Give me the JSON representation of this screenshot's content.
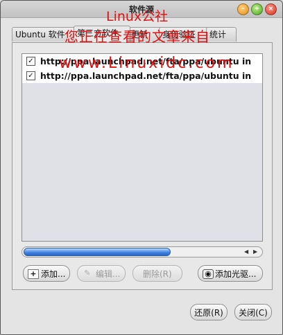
{
  "window": {
    "title": "软件源"
  },
  "tabs": [
    {
      "label": "Ubuntu 软件"
    },
    {
      "label": "第三方软件"
    },
    {
      "label": "更新"
    },
    {
      "label": "身份验证"
    },
    {
      "label": "统计"
    }
  ],
  "sources": [
    {
      "checked": true,
      "text": "http://ppa.launchpad.net/fta/ppa/ubuntu in"
    },
    {
      "checked": true,
      "text": "http://ppa.launchpad.net/fta/ppa/ubuntu in"
    }
  ],
  "scrollbar": {
    "position": 0
  },
  "buttons": {
    "add": "添加...",
    "edit": "编辑...",
    "remove": "删除(R)",
    "add_cdrom": "添加光驱..."
  },
  "footer": {
    "revert": "还原(R)",
    "close": "关闭(C)"
  },
  "watermark": {
    "line1": "Linux公社",
    "line2": "您正在查看的文章来自",
    "line3": "www.Linuxidc.com"
  }
}
